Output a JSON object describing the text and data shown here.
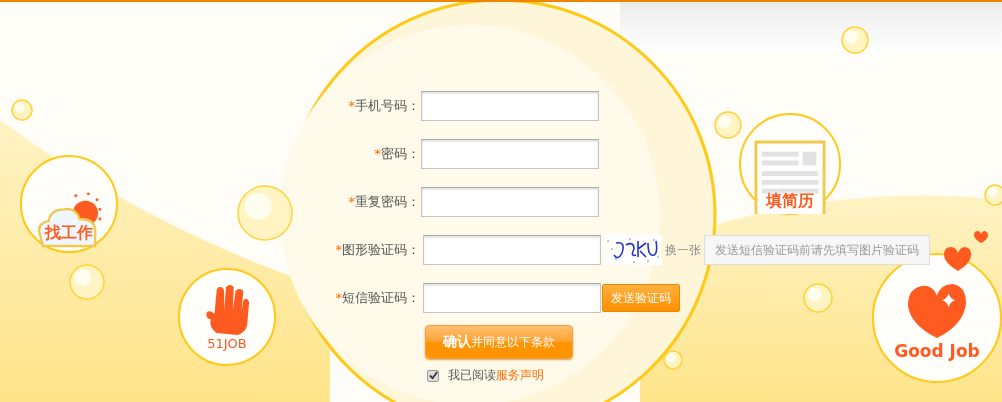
{
  "form": {
    "fields": [
      {
        "mark": "*",
        "label": "手机号码：",
        "kind": "text"
      },
      {
        "mark": "*",
        "label": "密码：",
        "kind": "text"
      },
      {
        "mark": "*",
        "label": "重复密码：",
        "kind": "text"
      },
      {
        "mark": "*",
        "label": "图形验证码：",
        "kind": "captcha",
        "refresh": "换一张",
        "hint": "发送短信验证码前请先填写图片验证码"
      },
      {
        "mark": "*",
        "label": "短信验证码：",
        "kind": "sms",
        "button": "发送验证码"
      }
    ],
    "submit": "**确认**并同意以下条款",
    "agree": {
      "checked": true,
      "text": "我已阅读",
      "link": "服务声明"
    }
  },
  "badges": [
    {
      "kind": "cloud",
      "label": "找工作"
    },
    {
      "kind": "hand",
      "label": "51JOB"
    },
    {
      "kind": "resume",
      "label": "填简历"
    },
    {
      "kind": "heart",
      "label": "Good Job"
    }
  ]
}
